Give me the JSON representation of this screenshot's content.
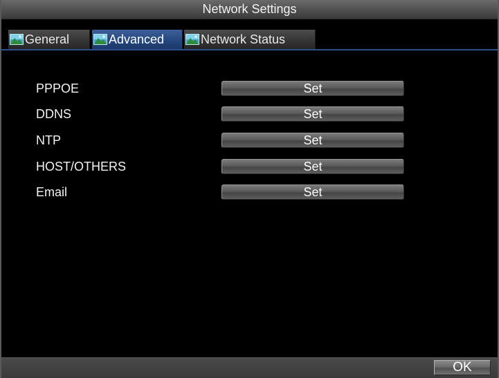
{
  "window": {
    "title": "Network Settings"
  },
  "tabs": [
    {
      "label": "General",
      "icon": "landscape-icon",
      "active": false
    },
    {
      "label": "Advanced",
      "icon": "landscape-icon",
      "active": true
    },
    {
      "label": "Network Status",
      "icon": "landscape-icon",
      "active": false
    }
  ],
  "settings": [
    {
      "label": "PPPOE",
      "button_label": "Set"
    },
    {
      "label": "DDNS",
      "button_label": "Set"
    },
    {
      "label": "NTP",
      "button_label": "Set"
    },
    {
      "label": "HOST/OTHERS",
      "button_label": "Set"
    },
    {
      "label": "Email",
      "button_label": "Set"
    }
  ],
  "footer": {
    "ok_label": "OK"
  },
  "colors": {
    "active_tab": "#24467d",
    "tab_underline": "#2b4f8f",
    "background": "#000000"
  }
}
